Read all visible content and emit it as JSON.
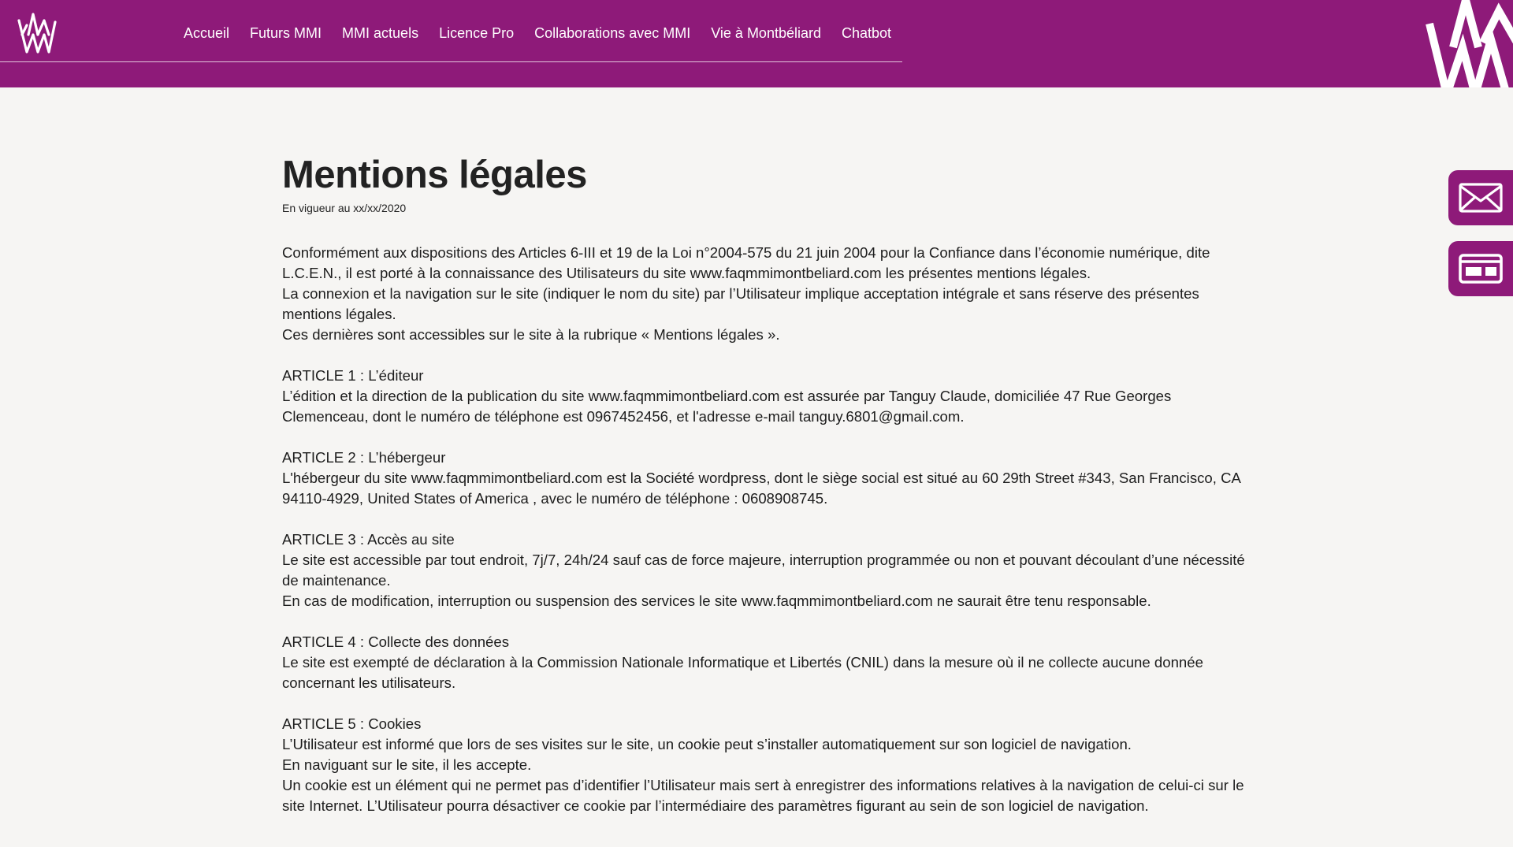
{
  "header": {
    "nav": [
      {
        "label": "Accueil"
      },
      {
        "label": "Futurs MMI"
      },
      {
        "label": "MMI actuels"
      },
      {
        "label": "Licence Pro"
      },
      {
        "label": "Collaborations avec MMI"
      },
      {
        "label": "Vie à Montbéliard"
      },
      {
        "label": "Chatbot"
      }
    ],
    "logo_icon": "crown-logo-icon",
    "accent_color": "#8e1a79"
  },
  "side_buttons": [
    {
      "icon": "mail-icon"
    },
    {
      "icon": "card-icon"
    }
  ],
  "main": {
    "title": "Mentions légales",
    "subtitle": "En vigueur au xx/xx/2020",
    "intro": [
      "Conformément aux dispositions des Articles 6-III et 19 de la Loi n°2004-575 du 21 juin 2004 pour la Confiance dans l’économie numérique, dite L.C.E.N., il est porté à la connaissance des Utilisateurs du site www.faqmmimontbeliard.com les présentes mentions légales.",
      "La connexion et la navigation sur le site (indiquer le nom du site) par l’Utilisateur implique acceptation intégrale et sans réserve des présentes mentions légales.",
      "Ces dernières sont accessibles sur le site à la rubrique « Mentions légales »."
    ],
    "articles": [
      {
        "heading": "ARTICLE 1 : L’éditeur",
        "paragraphs": [
          "L’édition et la direction de la publication du site www.faqmmimontbeliard.com est assurée par Tanguy Claude, domiciliée 47 Rue Georges Clemenceau, dont le numéro de téléphone est 0967452456, et l'adresse e-mail tanguy.6801@gmail.com."
        ]
      },
      {
        "heading": "ARTICLE 2 : L’hébergeur",
        "paragraphs": [
          "L'hébergeur du site www.faqmmimontbeliard.com est la Société wordpress, dont le siège social est situé au 60 29th Street #343, San Francisco, CA 94110-4929, United States of America , avec le numéro de téléphone : 0608908745."
        ]
      },
      {
        "heading": "ARTICLE 3 : Accès au site",
        "paragraphs": [
          "Le site est accessible par tout endroit, 7j/7, 24h/24 sauf cas de force majeure, interruption programmée ou non et pouvant découlant d’une nécessité de maintenance.",
          "En cas de modification, interruption ou suspension des services le site www.faqmmimontbeliard.com ne saurait être tenu responsable."
        ]
      },
      {
        "heading": "ARTICLE 4 : Collecte des données",
        "paragraphs": [
          "Le site est exempté de déclaration à la Commission Nationale Informatique et Libertés (CNIL) dans la mesure où il ne collecte aucune donnée concernant les utilisateurs."
        ]
      },
      {
        "heading": "ARTICLE 5 : Cookies",
        "paragraphs": [
          "L’Utilisateur est informé que lors de ses visites sur le site, un cookie peut s’installer automatiquement sur son logiciel de navigation.",
          "En naviguant sur le site, il les accepte.",
          "Un cookie est un élément qui ne permet pas d’identifier l’Utilisateur mais sert à enregistrer des informations relatives à la navigation de celui-ci sur le site Internet. L’Utilisateur pourra désactiver ce cookie par l’intermédiaire des paramètres figurant au sein de son logiciel de navigation."
        ]
      }
    ]
  }
}
